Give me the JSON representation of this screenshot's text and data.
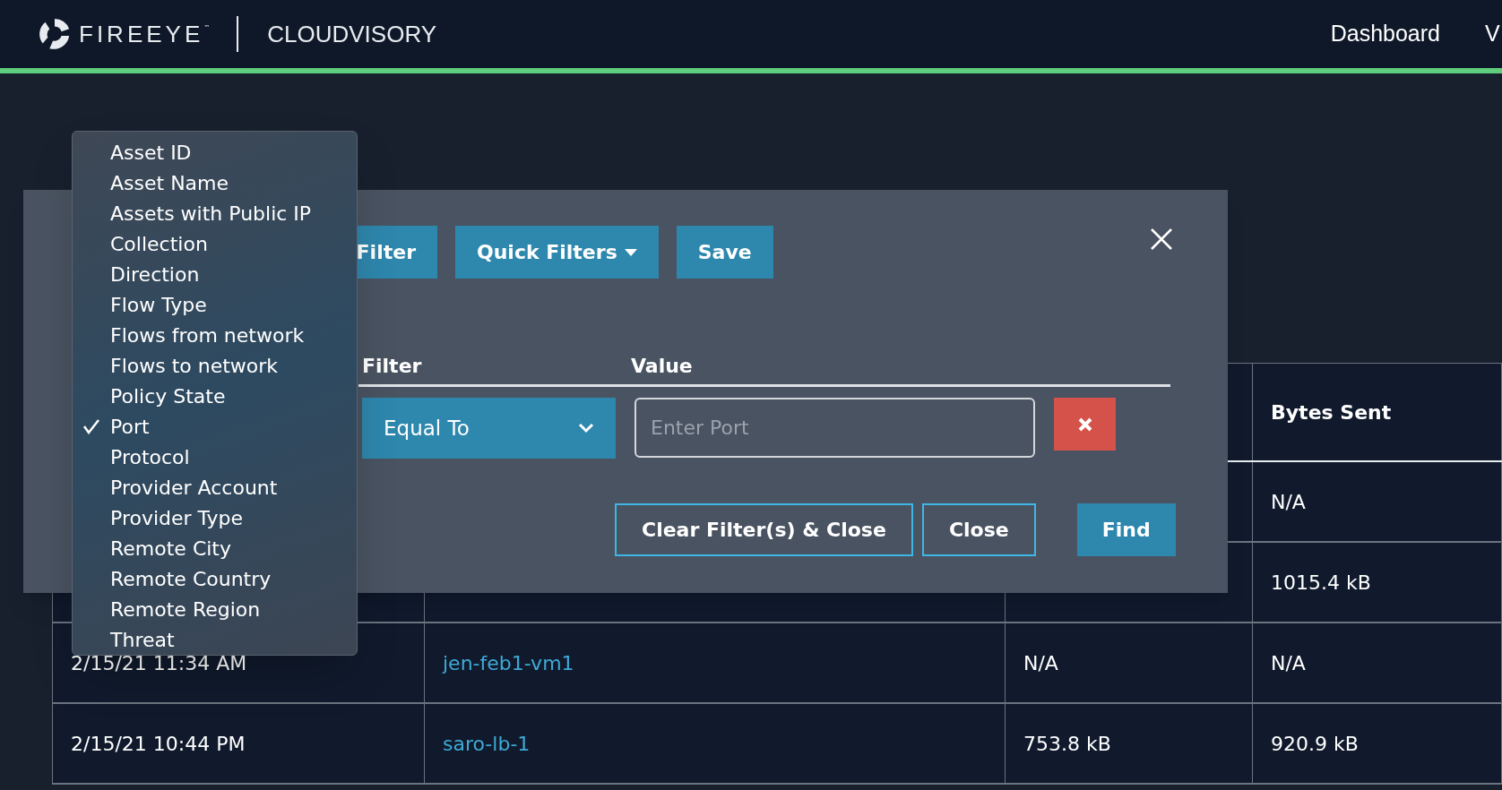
{
  "header": {
    "logo_text": "FIREEYE",
    "trademark": "™",
    "product": "CLOUDVISORY",
    "nav": [
      {
        "label": "Dashboard"
      },
      {
        "label": "V"
      }
    ]
  },
  "table": {
    "header": {
      "column_4": "Bytes Sent"
    },
    "rows": [
      {
        "column_4": "N/A"
      },
      {
        "column_4": "1015.4 kB"
      },
      {
        "column_1": "2/15/21 11:34 AM",
        "column_2": "jen-feb1-vm1",
        "column_3": "N/A",
        "column_4": "N/A"
      },
      {
        "column_1": "2/15/21 10:44 PM",
        "column_2": "saro-lb-1",
        "column_3": "753.8 kB",
        "column_4": "920.9 kB"
      }
    ]
  },
  "modal": {
    "buttons": [
      {
        "label": "Filter"
      },
      {
        "label": "Quick Filters",
        "caret": true
      },
      {
        "label": "Save",
        "caret": false
      }
    ],
    "columns": [
      "Filter",
      "Value"
    ],
    "operator": "Equal To",
    "value_placeholder": "Enter Port",
    "actions": [
      {
        "label": "Clear Filter(s) & Close",
        "kind": "outline"
      },
      {
        "label": "Close",
        "kind": "outline"
      },
      {
        "label": "Find",
        "kind": "primary"
      }
    ]
  },
  "field_menu": {
    "items": [
      {
        "label": "Asset ID",
        "selected": false
      },
      {
        "label": "Asset Name",
        "selected": false
      },
      {
        "label": "Assets with Public IP",
        "selected": false
      },
      {
        "label": "Collection",
        "selected": false
      },
      {
        "label": "Direction",
        "selected": false
      },
      {
        "label": "Flow Type",
        "selected": false
      },
      {
        "label": "Flows from network",
        "selected": false
      },
      {
        "label": "Flows to network",
        "selected": false
      },
      {
        "label": "Policy State",
        "selected": false
      },
      {
        "label": "Port",
        "selected": true
      },
      {
        "label": "Protocol",
        "selected": false
      },
      {
        "label": "Provider Account",
        "selected": false
      },
      {
        "label": "Provider Type",
        "selected": false
      },
      {
        "label": "Remote City",
        "selected": false
      },
      {
        "label": "Remote Country",
        "selected": false
      },
      {
        "label": "Remote Region",
        "selected": false
      },
      {
        "label": "Threat",
        "selected": false
      }
    ]
  }
}
